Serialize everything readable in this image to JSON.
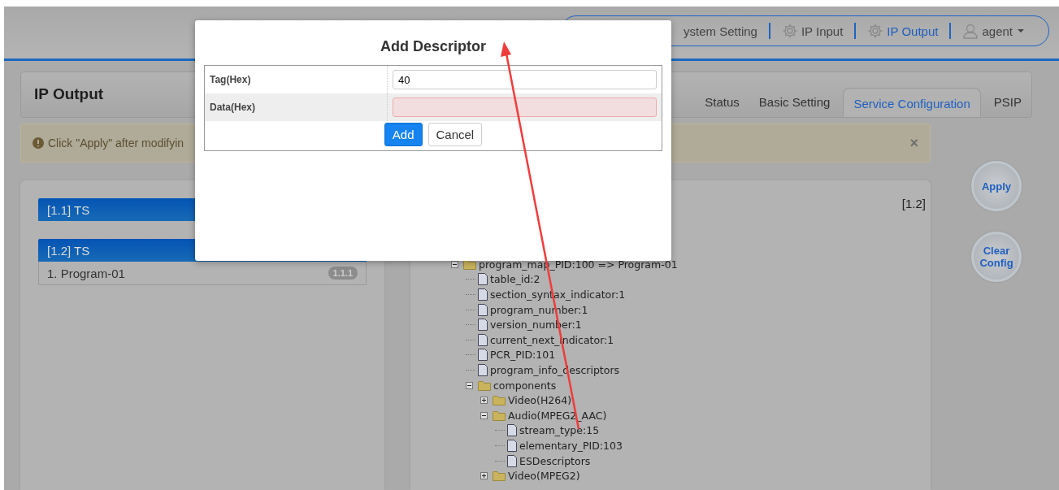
{
  "header": {
    "nav": [
      {
        "label": "ystem Setting",
        "kind": "page",
        "selected": false
      },
      {
        "label": "IP Input",
        "kind": "page",
        "selected": false
      },
      {
        "label": "IP Output",
        "kind": "page",
        "selected": true
      },
      {
        "label": "agent",
        "kind": "account",
        "selected": false
      }
    ]
  },
  "page": {
    "title": "IP Output",
    "tabs": [
      {
        "label": "Status",
        "selected": false
      },
      {
        "label": "Basic Setting",
        "selected": false
      },
      {
        "label": "Service Configuration",
        "selected": true
      },
      {
        "label": "PSIP",
        "selected": false
      }
    ]
  },
  "alert": {
    "text": "Click \"Apply\" after modifyin",
    "close": "×"
  },
  "actions": [
    "Apply",
    "Clear Config"
  ],
  "streams": [
    {
      "label": "[1.1] TS"
    },
    {
      "label": "[1.2] TS",
      "programs": [
        {
          "label": "1. Program-01",
          "badge": "1.1.1"
        }
      ]
    }
  ],
  "detail": {
    "tag": "[1.2]",
    "tree": [
      {
        "label": "program_map_PID:100 => Program-01",
        "kind": "folder",
        "expanded": true,
        "children": [
          {
            "label": "table_id:2",
            "kind": "file"
          },
          {
            "label": "section_syntax_indicator:1",
            "kind": "file"
          },
          {
            "label": "program_number:1",
            "kind": "file"
          },
          {
            "label": "version_number:1",
            "kind": "file"
          },
          {
            "label": "current_next_indicator:1",
            "kind": "file"
          },
          {
            "label": "PCR_PID:101",
            "kind": "file"
          },
          {
            "label": "program_info_descriptors",
            "kind": "file"
          },
          {
            "label": "components",
            "kind": "folder",
            "expanded": true,
            "children": [
              {
                "label": "Video(H264)",
                "kind": "folder",
                "expanded": false
              },
              {
                "label": "Audio(MPEG2_AAC)",
                "kind": "folder",
                "expanded": true,
                "children": [
                  {
                    "label": "stream_type:15",
                    "kind": "file"
                  },
                  {
                    "label": "elementary_PID:103",
                    "kind": "file"
                  },
                  {
                    "label": "ESDescriptors",
                    "kind": "file"
                  }
                ]
              },
              {
                "label": "Video(MPEG2)",
                "kind": "folder",
                "expanded": false
              }
            ]
          }
        ]
      }
    ]
  },
  "dialog": {
    "title": "Add Descriptor",
    "fields": [
      {
        "label": "Tag(Hex)",
        "value": "40",
        "invalid": false
      },
      {
        "label": "Data(Hex)",
        "invalid": true
      }
    ],
    "buttons": [
      {
        "label": "Add",
        "primary": true
      },
      {
        "label": "Cancel",
        "primary": false
      }
    ]
  }
}
